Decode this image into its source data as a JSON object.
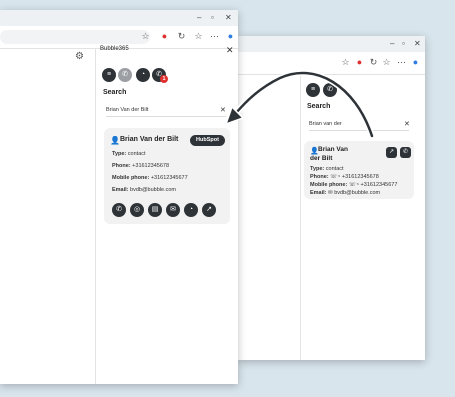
{
  "front": {
    "panel_title": "Bubble365",
    "search_label": "Search",
    "search_value": "Brian Van der Bilt",
    "contact": {
      "name": "Brian Van der Bilt",
      "button": "HubSpot",
      "type_label": "Type:",
      "type_value": "contact",
      "phone_label": "Phone:",
      "phone_value": "+31612345678",
      "mobile_label": "Mobile phone:",
      "mobile_value": "+31612345677",
      "email_label": "Email:",
      "email_value": "bvdb@bubble.com"
    },
    "badge_count": "1"
  },
  "back": {
    "search_label": "Search",
    "search_value": "Brian van der",
    "contact": {
      "name_line1": "Brian Van",
      "name_line2": "der Bilt",
      "type_label": "Type:",
      "type_value": "contact",
      "phone_label": "Phone:",
      "phone_value": "+31612345678",
      "mobile_label": "Mobile phone:",
      "mobile_value": "+31612345677",
      "email_label": "Email:",
      "email_value": "bvdb@bubble.com"
    }
  },
  "colors": {
    "dark_button": "#2e3338",
    "badge": "#e03131",
    "background": "#d8e5ec"
  }
}
